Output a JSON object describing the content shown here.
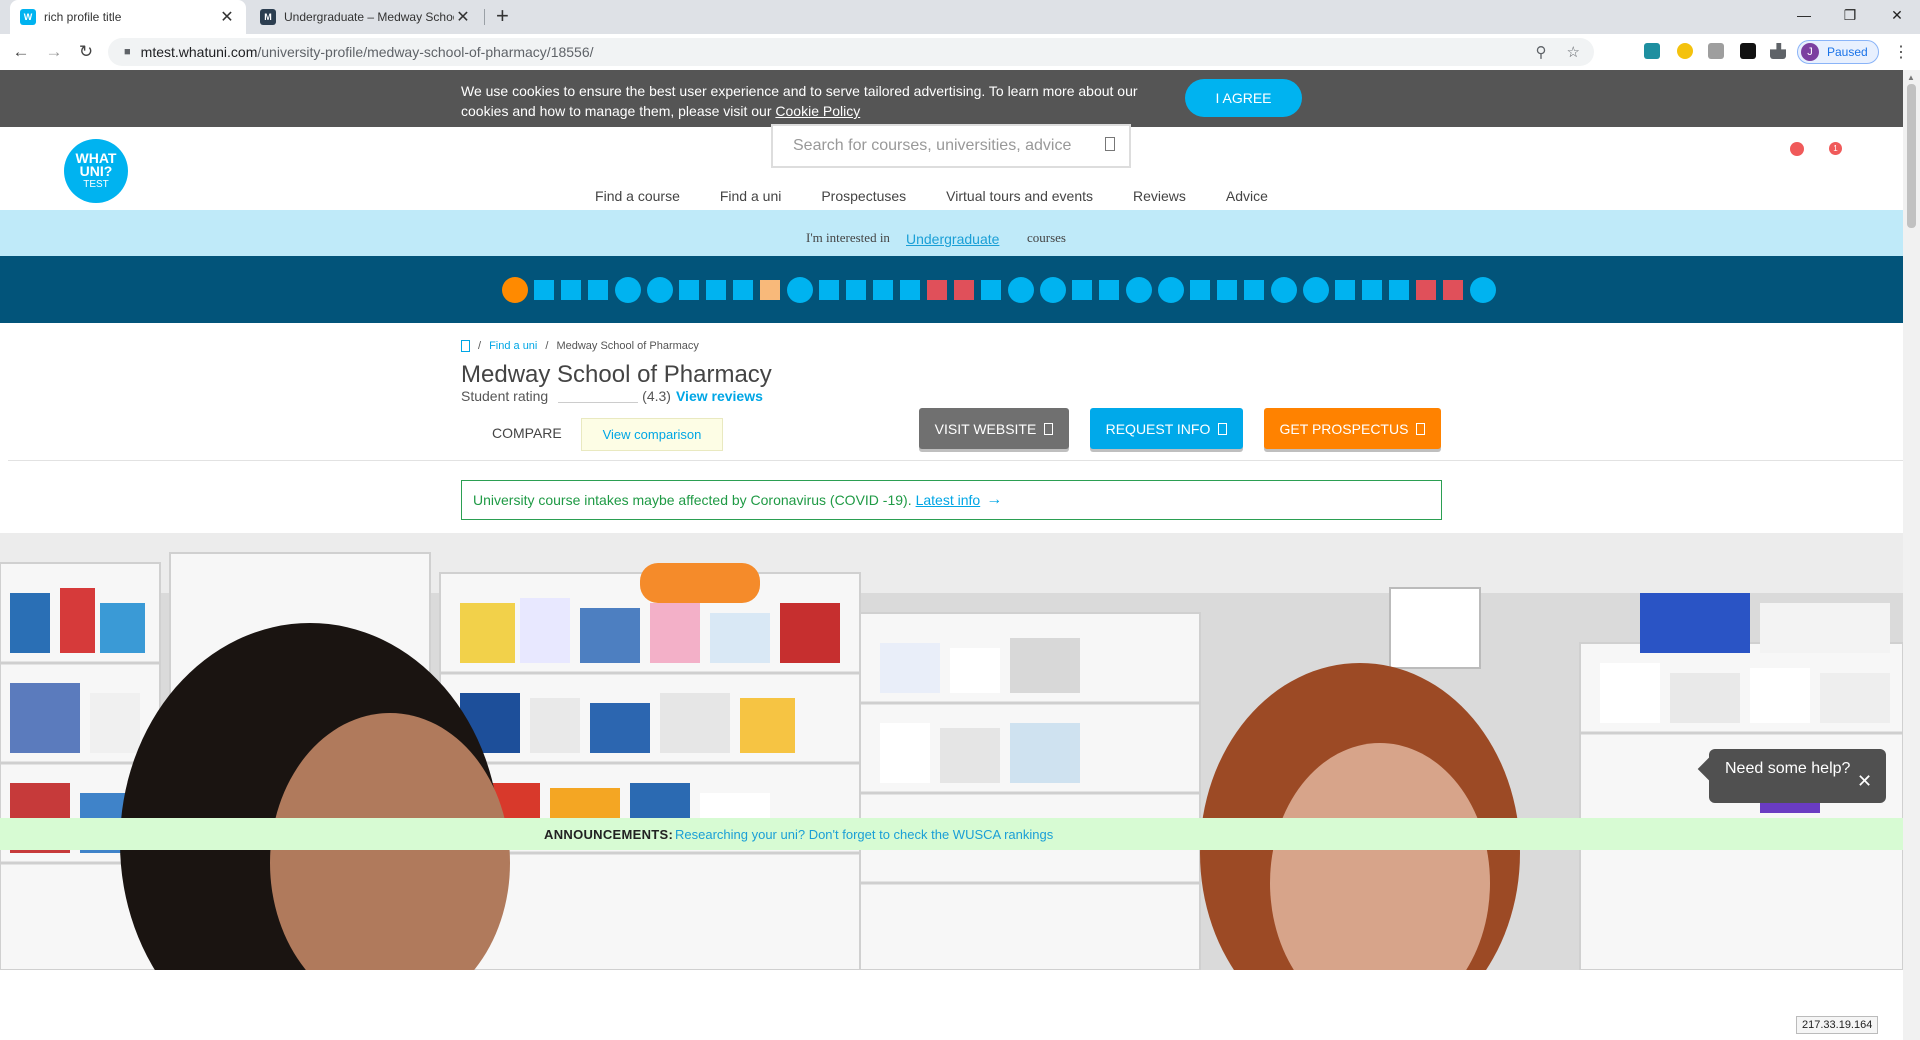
{
  "browser": {
    "tabs": [
      {
        "title": "rich profile title",
        "favicon": "whatuni-favicon",
        "active": true
      },
      {
        "title": "Undergraduate – Medway Schoo",
        "favicon": "medway-favicon",
        "active": false
      }
    ],
    "url_host": "mtest.whatuni.com",
    "url_path": "/university-profile/medway-school-of-pharmacy/18556/",
    "profile_initial": "J",
    "profile_status": "Paused"
  },
  "cookie_banner": {
    "text": "We use cookies to ensure the best user experience and to serve tailored advertising. To learn more about our cookies and how to manage them, please visit our ",
    "link": "Cookie Policy",
    "button": "I AGREE"
  },
  "header": {
    "logo_line1": "WHAT",
    "logo_line2": "UNI?",
    "logo_line3": "TEST",
    "search_placeholder": "Search for courses, universities, advice",
    "notification_count": "1"
  },
  "nav": [
    "Find a course",
    "Find a uni",
    "Prospectuses",
    "Virtual tours and events",
    "Reviews",
    "Advice"
  ],
  "interest_bar": {
    "prefix": "I'm interested in",
    "qualification": "Undergraduate",
    "suffix": "courses"
  },
  "breadcrumb": {
    "items": [
      "Find a uni",
      "Medway School of Pharmacy"
    ]
  },
  "profile": {
    "title": "Medway School of Pharmacy",
    "rating_label": "Student rating",
    "rating_value": "(4.3)",
    "reviews_link": "View reviews",
    "compare_label": "COMPARE",
    "view_comparison": "View comparison",
    "visit_website": "VISIT WEBSITE",
    "request_info": "REQUEST INFO",
    "get_prospectus": "GET PROSPECTUS"
  },
  "covid_notice": {
    "text": "University course intakes maybe affected by Coronavirus (COVID -19).",
    "link": "Latest info"
  },
  "help_widget": {
    "text": "Need some help?"
  },
  "announcement": {
    "label": "ANNOUNCEMENTS:",
    "message": "Researching your uni? Don't forget to check the WUSCA rankings"
  },
  "ip_badge": "217.33.19.164",
  "colors": {
    "brand_blue": "#00b3f0",
    "strip_navy": "#02547a",
    "cta_orange": "#ff8200",
    "cta_grey": "#707070",
    "covid_green": "#1f9a45"
  }
}
